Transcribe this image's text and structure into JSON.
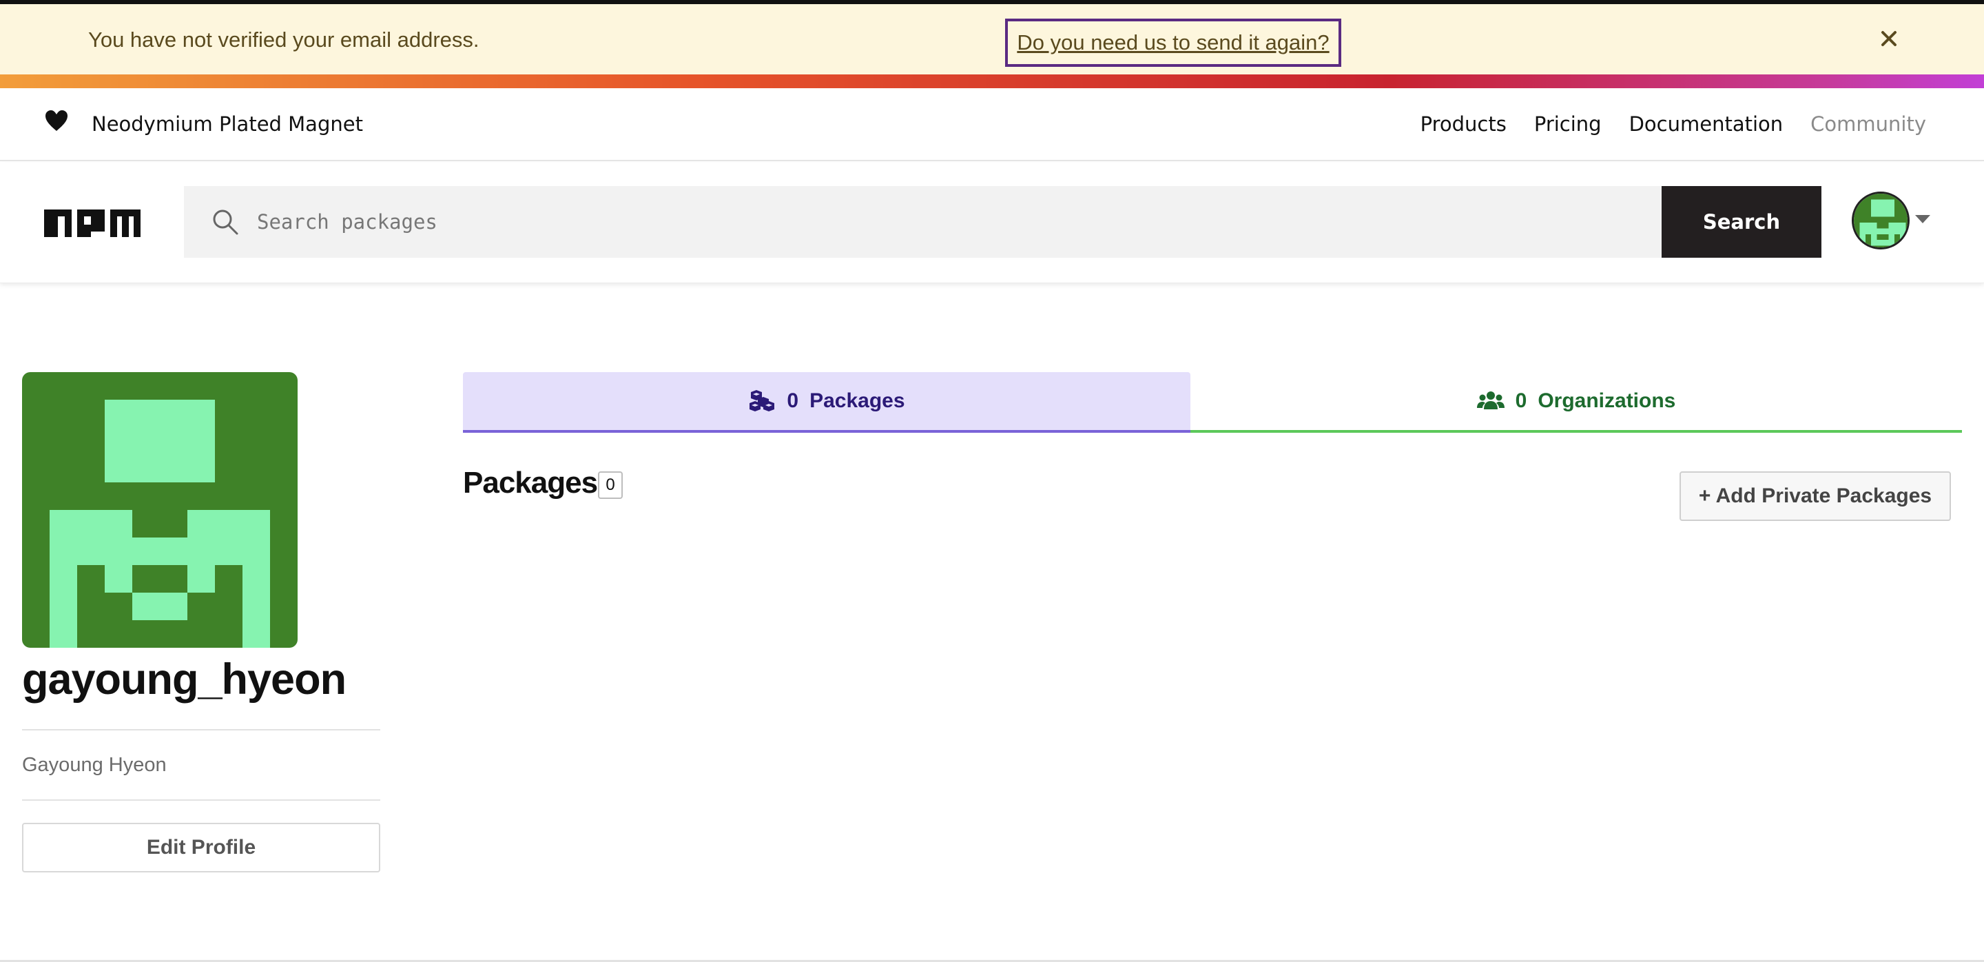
{
  "banner": {
    "message": "You have not verified your email address.",
    "resend_link": "Do you need us to send it again?"
  },
  "topnav": {
    "tagline": "Neodymium Plated Magnet",
    "links": [
      "Products",
      "Pricing",
      "Documentation",
      "Community"
    ]
  },
  "search": {
    "placeholder": "Search packages",
    "button_label": "Search"
  },
  "profile": {
    "username": "gayoung_hyeon",
    "full_name": "Gayoung Hyeon",
    "edit_label": "Edit Profile",
    "avatar_colors": {
      "background": "#3f8228",
      "foreground": "#86f3b0"
    }
  },
  "tabs": [
    {
      "count": "0",
      "label": "Packages",
      "active": true
    },
    {
      "count": "0",
      "label": "Organizations",
      "active": false
    }
  ],
  "packages": {
    "title": "Packages",
    "count": "0",
    "add_private_label": "+ Add Private Packages"
  },
  "colors": {
    "banner_bg": "#fdf6dd",
    "active_tab_bg": "#e4dffb",
    "active_tab_border": "#7a63d8",
    "orgs_tab_border": "#5cc85a",
    "search_button_bg": "#231f20"
  }
}
